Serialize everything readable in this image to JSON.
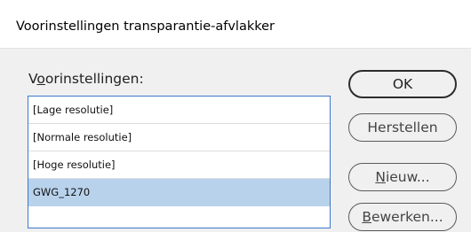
{
  "dialog": {
    "title": "Voorinstellingen transparantie-afvlakker"
  },
  "presets": {
    "label_pre": "V",
    "label_mnemonic": "o",
    "label_post": "orinstellingen:",
    "items": [
      {
        "label": "[Lage resolutie]",
        "selected": false
      },
      {
        "label": "[Normale resolutie]",
        "selected": false
      },
      {
        "label": "[Hoge resolutie]",
        "selected": false
      },
      {
        "label": "GWG_1270",
        "selected": true
      }
    ]
  },
  "buttons": {
    "ok": {
      "label": "OK"
    },
    "reset": {
      "label": "Herstellen"
    },
    "new": {
      "mnemonic": "N",
      "rest": "ieuw..."
    },
    "edit": {
      "mnemonic": "B",
      "rest": "ewerken..."
    }
  },
  "colors": {
    "selection": "#b9d2ec",
    "list_border": "#3e78c8",
    "dialog_bg": "#f0f0f0"
  }
}
